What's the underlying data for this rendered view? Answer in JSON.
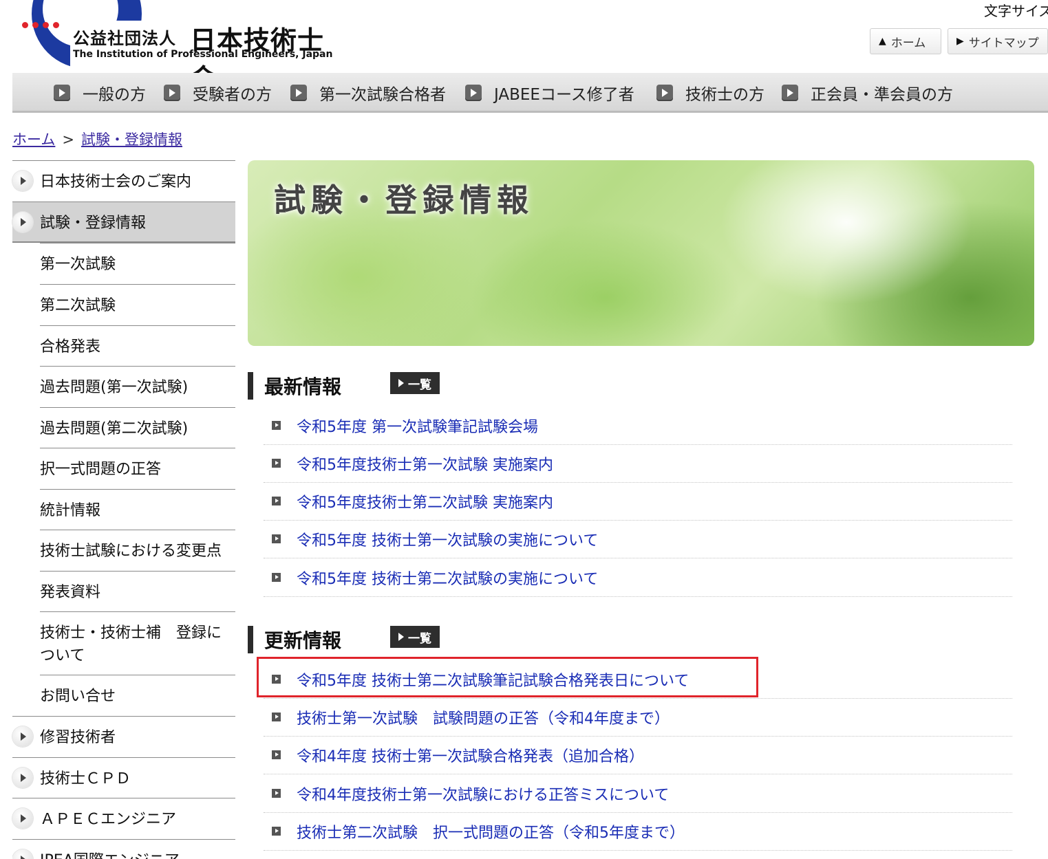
{
  "header": {
    "logo_org_type": "公益社団法人",
    "logo_org_name": "日本技術士会",
    "logo_org_name_en": "The Institution of Professional Engineers, Japan",
    "font_size_label": "文字サイズ",
    "home_button": "ホーム",
    "sitemap_button": "サイトマップ",
    "logo_colors": {
      "blue": "#1c3aa0",
      "red": "#e0242b"
    }
  },
  "global_nav": [
    "一般の方",
    "受験者の方",
    "第一次試験合格者",
    "JABEEコース修了者",
    "技術士の方",
    "正会員・準会員の方"
  ],
  "breadcrumb": {
    "home": "ホーム",
    "separator": ">",
    "current": "試験・登録情報"
  },
  "sidebar": {
    "items": [
      {
        "label": "日本技術士会のご案内"
      },
      {
        "label": "試験・登録情報"
      },
      {
        "label": "第一次試験"
      },
      {
        "label": "第二次試験"
      },
      {
        "label": "合格発表"
      },
      {
        "label": "過去問題(第一次試験)"
      },
      {
        "label": "過去問題(第二次試験)"
      },
      {
        "label": "択一式問題の正答"
      },
      {
        "label": "統計情報"
      },
      {
        "label": "技術士試験における変更点"
      },
      {
        "label": "発表資料"
      },
      {
        "label": "技術士・技術士補　登録について"
      },
      {
        "label": "お問い合せ"
      },
      {
        "label": "修習技術者"
      },
      {
        "label": "技術士ＣＰＤ"
      },
      {
        "label": "ＡＰＥＣエンジニア"
      },
      {
        "label": "IPEA国際エンジニア"
      }
    ]
  },
  "banner": {
    "title": "試験・登録情報"
  },
  "latest": {
    "title": "最新情報",
    "list_button": "一覧",
    "items": [
      "令和5年度 第一次試験筆記試験会場",
      "令和5年度技術士第一次試験 実施案内",
      "令和5年度技術士第二次試験 実施案内",
      "令和5年度 技術士第一次試験の実施について",
      "令和5年度 技術士第二次試験の実施について"
    ]
  },
  "updates": {
    "title": "更新情報",
    "list_button": "一覧",
    "items": [
      "令和5年度 技術士第二次試験筆記試験合格発表日について",
      "技術士第一次試験　試験問題の正答（令和4年度まで）",
      "令和4年度 技術士第一次試験合格発表（追加合格）",
      "令和4年度技術士第一次試験における正答ミスについて",
      "技術士第二次試験　択一式問題の正答（令和5年度まで）"
    ]
  }
}
